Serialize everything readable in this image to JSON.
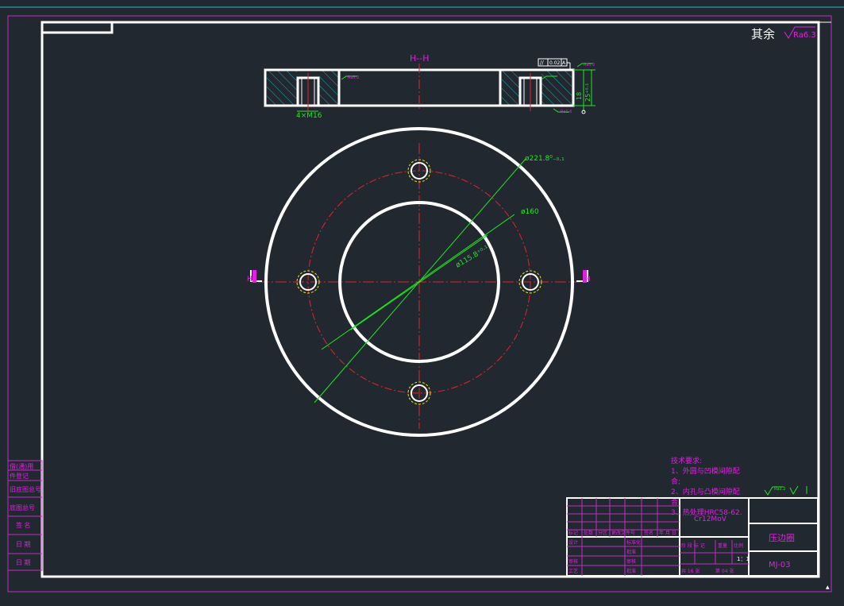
{
  "drawing": {
    "section_label": "H--H",
    "view_marker_left": "H",
    "view_marker_right": "H",
    "surface_finish_other_prefix": "其余",
    "surface_finish_other_value": "Ra6.3",
    "roughness_top": "Ra3.2",
    "roughness_mid": "Ra3.2",
    "roughness_bottom": "Ra1.6",
    "parallelism_value": "0.02",
    "datum": "A",
    "hole_callout": "4×M16",
    "dim_outer": "ø221.8⁰₋₀.₁",
    "dim_bolt_circle": "ø160",
    "dim_inner": "ø115.8⁺⁰·¹",
    "dim_thickness": "18",
    "dim_depth": "25⁺⁰·¹",
    "roughness_note": "Ra3.2"
  },
  "tech_requirements": {
    "title": "技术要求:",
    "lines": [
      "1、外圆与凹模间隙配",
      "合;",
      "2、内孔与凸模间隙配",
      "合",
      "3、热处理HRC58-62."
    ]
  },
  "title_block": {
    "material": "Cr12MoV",
    "part_name": "压边圈",
    "drawing_no": "MJ-03",
    "scale": "1：1",
    "sheets_total": "共 16 张",
    "sheet_no": "第 04 张",
    "rev_headers": [
      "标记",
      "处数",
      "分区",
      "更改文件号",
      "签名",
      "年 月 日"
    ],
    "roles_left": [
      "设计",
      "",
      "审核",
      "工艺"
    ],
    "roles_mid": [
      "标准化",
      "批准",
      "审核",
      "批准"
    ],
    "stage_headers": [
      "阶 段 标 记",
      "重量",
      "比例"
    ],
    "side_stamp_labels": [
      "借(通)用",
      "件登记",
      "旧底图总号",
      "底图总号",
      "签 名",
      "日 期",
      "日 期"
    ]
  },
  "colors": {
    "background": "#212830",
    "outline": "#ffffff",
    "center": "#e0262a",
    "dimension": "#1fe81f",
    "text_magenta": "#e020e0",
    "hidden": "#e8e020",
    "hatch": "#1faab4"
  }
}
